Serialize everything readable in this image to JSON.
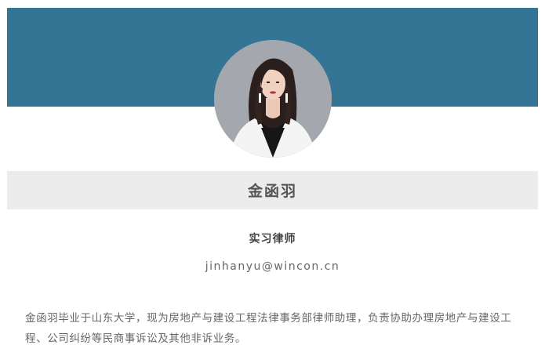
{
  "profile": {
    "name": "金函羽",
    "title": "实习律师",
    "email": "jinhanyu@wincon.cn",
    "bio": "金函羽毕业于山东大学，现为房地产与建设工程法律事务部律师助理，负责协助办理房地产与建设工程、公司纠纷等民商事诉讼及其他非诉业务。"
  },
  "colors": {
    "banner": "#347595",
    "name_bar": "#ececec",
    "text": "#666666"
  },
  "icons": {
    "portrait": "portrait-photo-icon"
  }
}
